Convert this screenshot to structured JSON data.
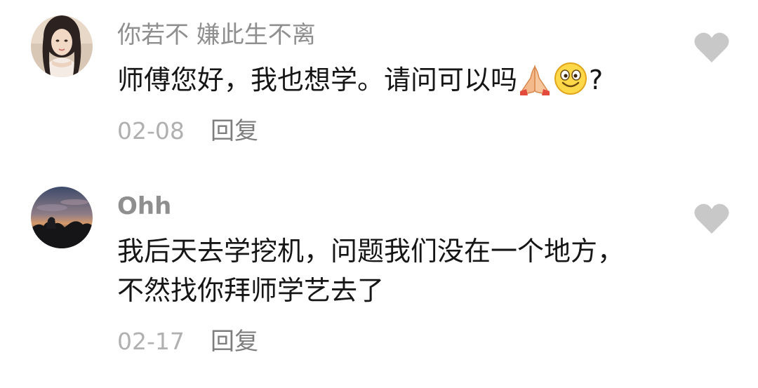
{
  "comments": [
    {
      "username": "你若不 嫌此生不离",
      "text_before": "师傅您好，我也想学。请问可以吗",
      "emojis": [
        "folded-hands-emoji",
        "smiling-face-emoji"
      ],
      "text_after": "?",
      "date": "02-08",
      "reply_label": "回复",
      "like_icon": "heart-icon"
    },
    {
      "username": "Ohh",
      "lines": [
        "我后天去学挖机，问题我们没在一个地方，",
        "不然找你拜师学艺去了"
      ],
      "date": "02-17",
      "reply_label": "回复",
      "like_icon": "heart-icon"
    }
  ],
  "colors": {
    "username": "#8f8f8f",
    "text": "#161616",
    "date": "#b0b0b0",
    "reply": "#7e7e7e",
    "heart": "#c8c8c8"
  }
}
